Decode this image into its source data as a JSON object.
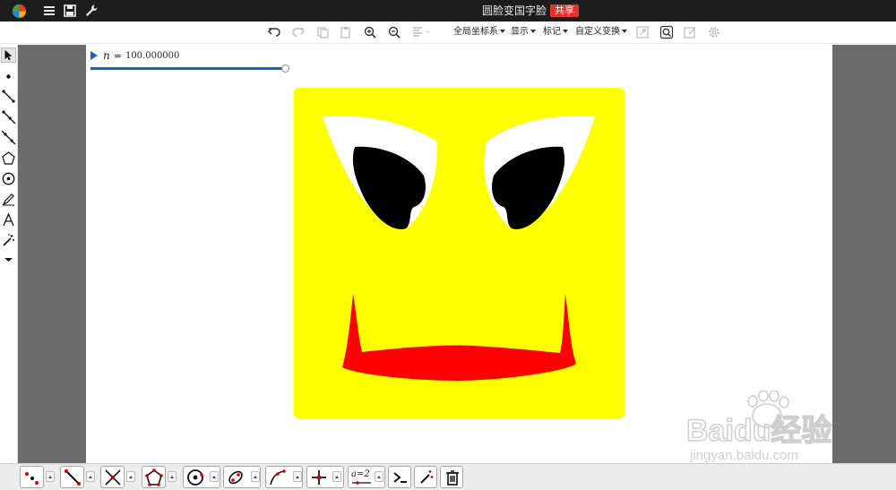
{
  "app": {
    "document_title": "圆脸变国字脸",
    "share_label": "共享"
  },
  "toolbar": {
    "menus": [
      {
        "label": "全局坐标系"
      },
      {
        "label": "显示"
      },
      {
        "label": "标记"
      },
      {
        "label": "自定义变换"
      }
    ]
  },
  "slider": {
    "variable": "n",
    "equals": "=",
    "value": "100.000000",
    "fill_fraction": 1.0
  },
  "watermark": {
    "brand": "Baidu经验",
    "url": "jingyan.baidu.com"
  },
  "bottom_tools": {
    "text_tool_label": "a=2"
  },
  "colors": {
    "face": "#ffff00",
    "eye_white": "#ffffff",
    "pupil": "#000000",
    "mouth": "#ff0000",
    "accent": "#1565c0",
    "share": "#e8312a"
  }
}
